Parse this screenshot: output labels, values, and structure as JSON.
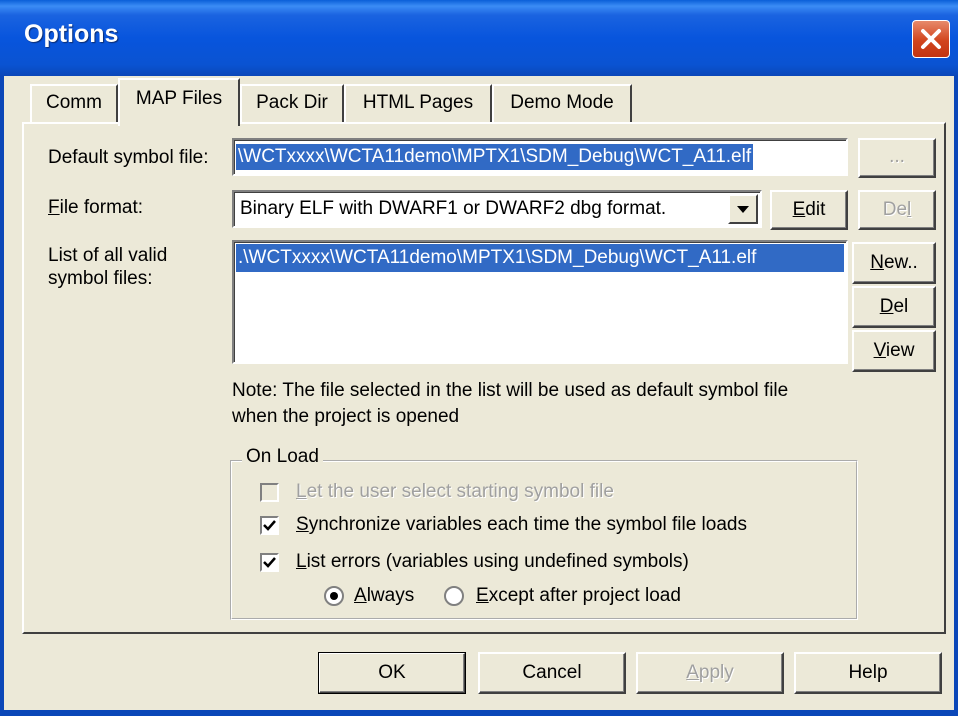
{
  "window": {
    "title": "Options"
  },
  "tabs": [
    {
      "label": "Comm"
    },
    {
      "label": "MAP Files"
    },
    {
      "label": "Pack Dir"
    },
    {
      "label": "HTML Pages"
    },
    {
      "label": "Demo Mode"
    }
  ],
  "map_files": {
    "default_symbol_label": "Default symbol file:",
    "default_symbol_value": "\\WCTxxxx\\WCTA11demo\\MPTX1\\SDM_Debug\\WCT_A11.elf",
    "browse_label": "...",
    "file_format_label_pre": "",
    "file_format_label_u": "F",
    "file_format_label_post": "ile format:",
    "file_format_value": "Binary ELF with DWARF1 or DWARF2 dbg format.",
    "edit_u": "E",
    "edit_rest": "dit",
    "del_top_pre": "De",
    "del_top_u": "l",
    "list_label_line1": "List of all valid",
    "list_label_line2": "symbol files:",
    "symbol_files": [
      ".\\WCTxxxx\\WCTA11demo\\MPTX1\\SDM_Debug\\WCT_A11.elf"
    ],
    "new_u": "N",
    "new_rest": "ew..",
    "del_u": "D",
    "del_rest": "el",
    "view_u": "V",
    "view_rest": "iew",
    "note_line1": "Note: The file selected in the list will be used as default symbol file",
    "note_line2": "when the project is opened"
  },
  "on_load": {
    "title": "On Load",
    "let_user_u": "L",
    "let_user_rest": "et the user select starting symbol file",
    "sync_u": "S",
    "sync_rest": "ynchronize variables each time the symbol file loads",
    "list_errors_u": "L",
    "list_errors_rest": "ist errors (variables using undefined symbols)",
    "always_u": "A",
    "always_rest": "lways",
    "except_u": "E",
    "except_rest": "xcept after project load",
    "let_user_checked": false,
    "sync_checked": true,
    "list_errors_checked": true,
    "radio_selected": "Always"
  },
  "buttons": {
    "ok": "OK",
    "cancel": "Cancel",
    "apply_u": "A",
    "apply_rest": "pply",
    "help": "Help"
  }
}
